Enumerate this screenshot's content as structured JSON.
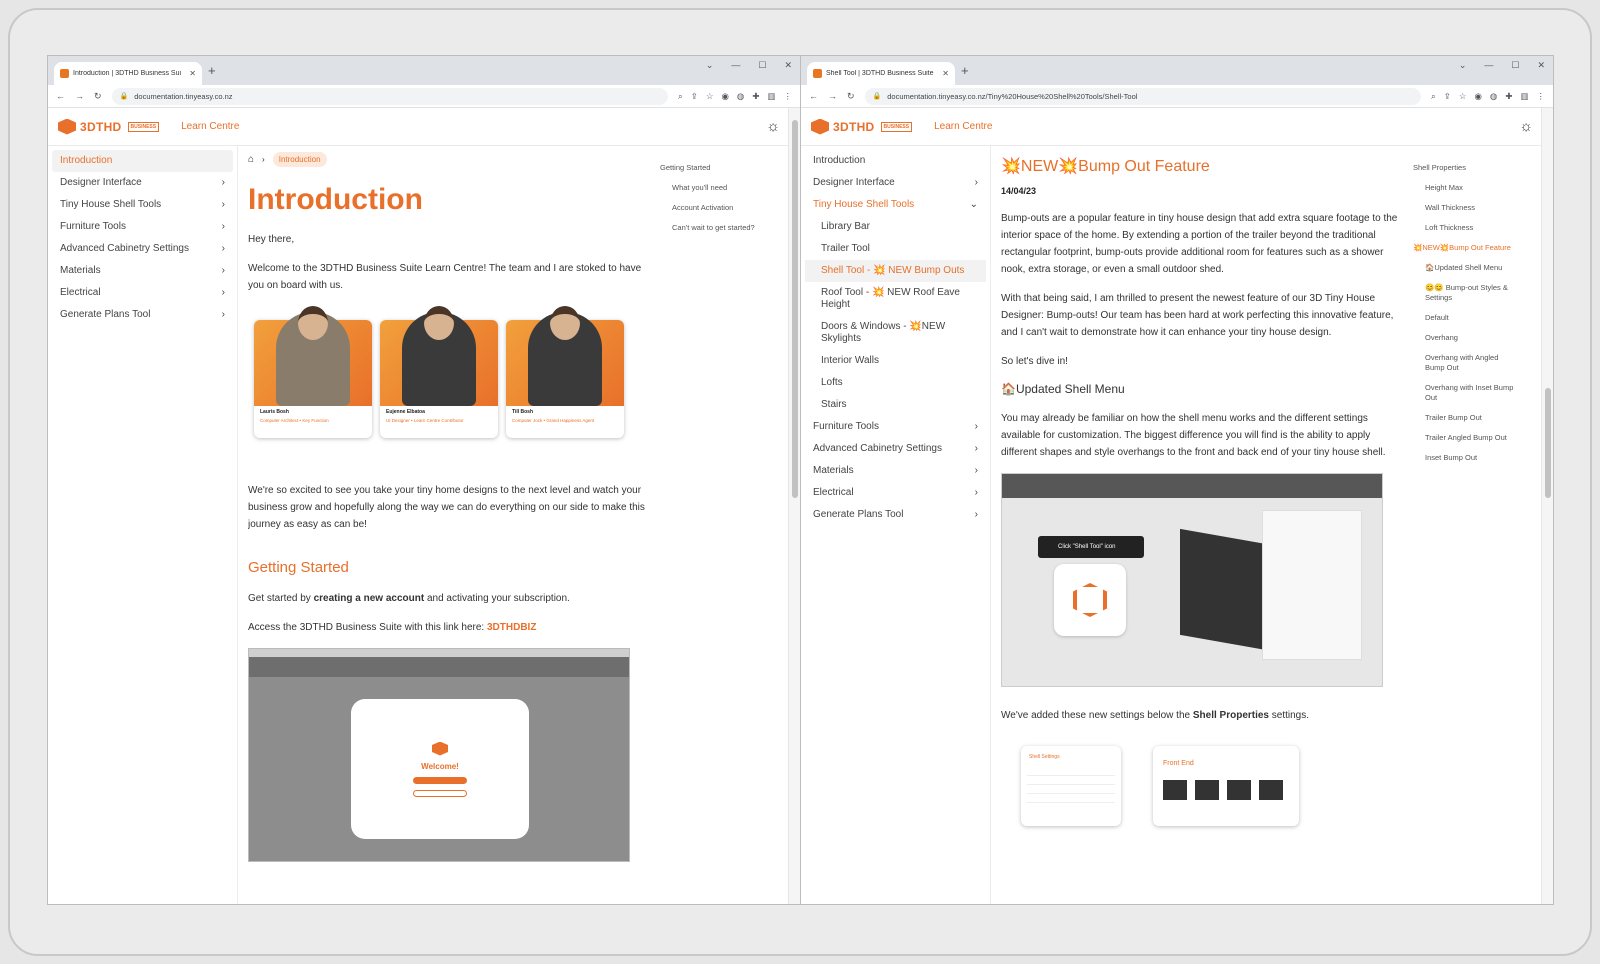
{
  "left": {
    "tab_title": "Introduction | 3DTHD Business Sui",
    "url": "documentation.tinyeasy.co.nz",
    "logo": {
      "word": "3DTHD",
      "badge": "BUSINESS"
    },
    "learn_centre": "Learn Centre",
    "sidebar": [
      {
        "label": "Introduction",
        "active": true
      },
      {
        "label": "Designer Interface"
      },
      {
        "label": "Tiny House Shell Tools"
      },
      {
        "label": "Furniture Tools"
      },
      {
        "label": "Advanced Cabinetry Settings"
      },
      {
        "label": "Materials"
      },
      {
        "label": "Electrical"
      },
      {
        "label": "Generate Plans Tool"
      }
    ],
    "breadcrumb": "Introduction",
    "title": "Introduction",
    "p1": "Hey there,",
    "p2": "Welcome to the 3DTHD Business Suite Learn Centre! The team and I are stoked to have you on board with us.",
    "team": [
      {
        "name": "Lauris Bosh",
        "role": "Computer Architect • Key Function"
      },
      {
        "name": "Eujenne Elbatoa",
        "role": "UI Designer • Learn Centre Contributor"
      },
      {
        "name": "Till Bosh",
        "role": "Computer Jock • Grand Happiness Agent"
      }
    ],
    "p3": "We're so excited to see you take your tiny home designs to the next level and watch your business grow and hopefully along the way we can do everything on our side to make this journey as easy as can be!",
    "h_getting_started": "Getting Started",
    "p4_pre": "Get started by ",
    "p4_bold": "creating a new account",
    "p4_post": " and activating your subscription.",
    "p5_pre": "Access the 3DTHD Business Suite with this link here: ",
    "p5_link": "3DTHDBIZ",
    "modal_title": "Welcome!",
    "toc": [
      "Getting Started",
      "What you'll need",
      "Account Activation",
      "Can't wait to get started?"
    ]
  },
  "right": {
    "tab_title": "Shell Tool | 3DTHD Business Suite",
    "url": "documentation.tinyeasy.co.nz/Tiny%20House%20Shell%20Tools/Shell-Tool",
    "logo": {
      "word": "3DTHD",
      "badge": "BUSINESS"
    },
    "learn_centre": "Learn Centre",
    "sidebar_top": [
      {
        "label": "Introduction"
      },
      {
        "label": "Designer Interface"
      },
      {
        "label": "Tiny House Shell Tools"
      }
    ],
    "sidebar_sub": [
      "Library Bar",
      "Trailer Tool",
      "Shell Tool - 💥 NEW Bump Outs",
      "Roof Tool - 💥 NEW Roof Eave Height",
      "Doors & Windows - 💥NEW Skylights",
      "Interior Walls",
      "Lofts",
      "Stairs"
    ],
    "sidebar_bottom": [
      "Furniture Tools",
      "Advanced Cabinetry Settings",
      "Materials",
      "Electrical",
      "Generate Plans Tool"
    ],
    "title": "💥NEW💥Bump Out Feature",
    "date": "14/04/23",
    "p1": "Bump-outs are a popular feature in tiny house design that add extra square footage to the interior space of the home. By extending a portion of the trailer beyond the traditional rectangular footprint, bump-outs provide additional room for features such as a shower nook, extra storage, or even a small outdoor shed.",
    "p2": "With that being said, I am thrilled to present the newest feature of our 3D Tiny House Designer: Bump-outs! Our team has been hard at work perfecting this innovative feature, and I can't wait to demonstrate how it can enhance your tiny house design.",
    "p3": "So let's dive in!",
    "h_updated": "🏠Updated Shell Menu",
    "p4": "You may already be familiar on how the shell menu works and the different settings available for customization. The biggest difference you will find is the ability to apply different shapes and style overhangs to the front and back end of your tiny house shell.",
    "shot_tip": "Click \"Shell Tool\" icon",
    "p5_pre": "We've added these new settings below the ",
    "p5_bold": "Shell Properties",
    "p5_post": " settings.",
    "shot3_left": "Shell Settings",
    "shot3_right": "Front End",
    "toc": [
      {
        "label": "Shell Properties"
      },
      {
        "label": "Height Max",
        "sub": true
      },
      {
        "label": "Wall Thickness",
        "sub": true
      },
      {
        "label": "Loft Thickness",
        "sub": true
      },
      {
        "label": "💥NEW💥Bump Out Feature",
        "orange": true
      },
      {
        "label": "🏠Updated Shell Menu",
        "sub": true
      },
      {
        "label": "😊😊 Bump-out Styles & Settings",
        "sub": true
      },
      {
        "label": "Default",
        "sub": true
      },
      {
        "label": "Overhang",
        "sub": true
      },
      {
        "label": "Overhang with Angled Bump Out",
        "sub": true
      },
      {
        "label": "Overhang with Inset Bump Out",
        "sub": true
      },
      {
        "label": "Trailer Bump Out",
        "sub": true
      },
      {
        "label": "Trailer Angled Bump Out",
        "sub": true
      },
      {
        "label": "Inset Bump Out",
        "sub": true
      }
    ]
  }
}
